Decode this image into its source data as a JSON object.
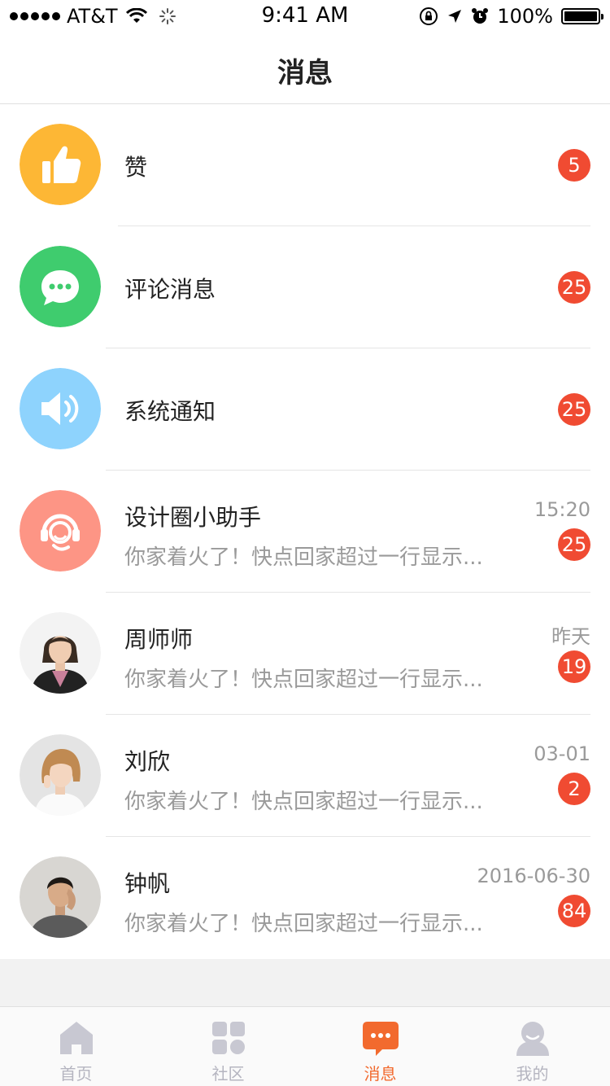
{
  "status_bar": {
    "carrier": "AT&T",
    "time": "9:41 AM",
    "battery": "100%"
  },
  "nav": {
    "title": "消息"
  },
  "rows": [
    {
      "kind": "like",
      "title": "赞",
      "badge": "5"
    },
    {
      "kind": "comment",
      "title": "评论消息",
      "badge": "25"
    },
    {
      "kind": "notice",
      "title": "系统通知",
      "badge": "25"
    },
    {
      "kind": "assistant",
      "title": "设计圈小助手",
      "preview": "你家着火了！快点回家超过一行显示...",
      "time": "15:20",
      "badge": "25"
    },
    {
      "kind": "person",
      "title": "周师师",
      "preview": "你家着火了！快点回家超过一行显示...",
      "time": "昨天",
      "badge": "19"
    },
    {
      "kind": "person",
      "title": "刘欣",
      "preview": "你家着火了！快点回家超过一行显示...",
      "time": "03-01",
      "badge": "2"
    },
    {
      "kind": "person",
      "title": "钟帆",
      "preview": "你家着火了！快点回家超过一行显示...",
      "time": "2016-06-30",
      "badge": "84"
    }
  ],
  "tabs": [
    {
      "label": "首页",
      "icon": "home-icon"
    },
    {
      "label": "社区",
      "icon": "community-icon"
    },
    {
      "label": "消息",
      "icon": "message-icon",
      "active": true
    },
    {
      "label": "我的",
      "icon": "profile-icon"
    }
  ],
  "colors": {
    "like": "#fdb735",
    "comment": "#3fcc6e",
    "notice": "#8ed3fd",
    "assistant": "#fd9585",
    "badge": "#f04b32",
    "tab_active": "#f26a2e",
    "tab_inactive": "#c8c8d2"
  }
}
